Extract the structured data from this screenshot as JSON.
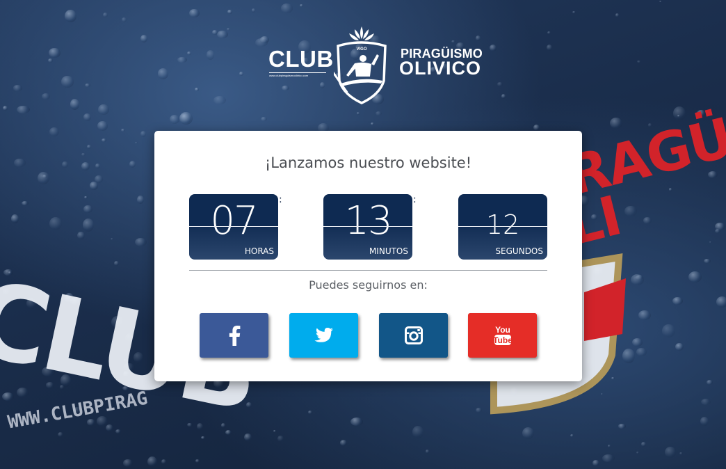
{
  "logo": {
    "club": "CLUB",
    "club_url": "www.clubpiraguismoolivico.com",
    "emblem_top_text": "VIGO",
    "piraguismo": "PIRAGÜISMO",
    "olivico": "OLIVICO"
  },
  "background": {
    "club_word": "CLUB",
    "url_word": "WWW.CLUBPIRAG",
    "red_word_top": "PIRAGÜ",
    "red_word_bottom": "OLI"
  },
  "card": {
    "title": "¡Lanzamos nuestro website!",
    "countdown": [
      {
        "value": "07",
        "label": "HORAS"
      },
      {
        "value": "13",
        "label": "MINUTOS"
      },
      {
        "value": "12",
        "label": "SEGUNDOS"
      }
    ],
    "separator": ":",
    "follow_text": "Puedes seguirnos en:"
  },
  "social": [
    {
      "name": "facebook",
      "icon": "facebook-icon",
      "color": "#3b5998"
    },
    {
      "name": "twitter",
      "icon": "twitter-icon",
      "color": "#00aced"
    },
    {
      "name": "instagram",
      "icon": "instagram-icon",
      "color": "#125688"
    },
    {
      "name": "youtube",
      "icon": "youtube-icon",
      "color": "#e52d27"
    }
  ],
  "colors": {
    "countdown_bg": "#0e2a52",
    "brand_red": "#d2232a",
    "brand_gold": "#b59a5a"
  }
}
